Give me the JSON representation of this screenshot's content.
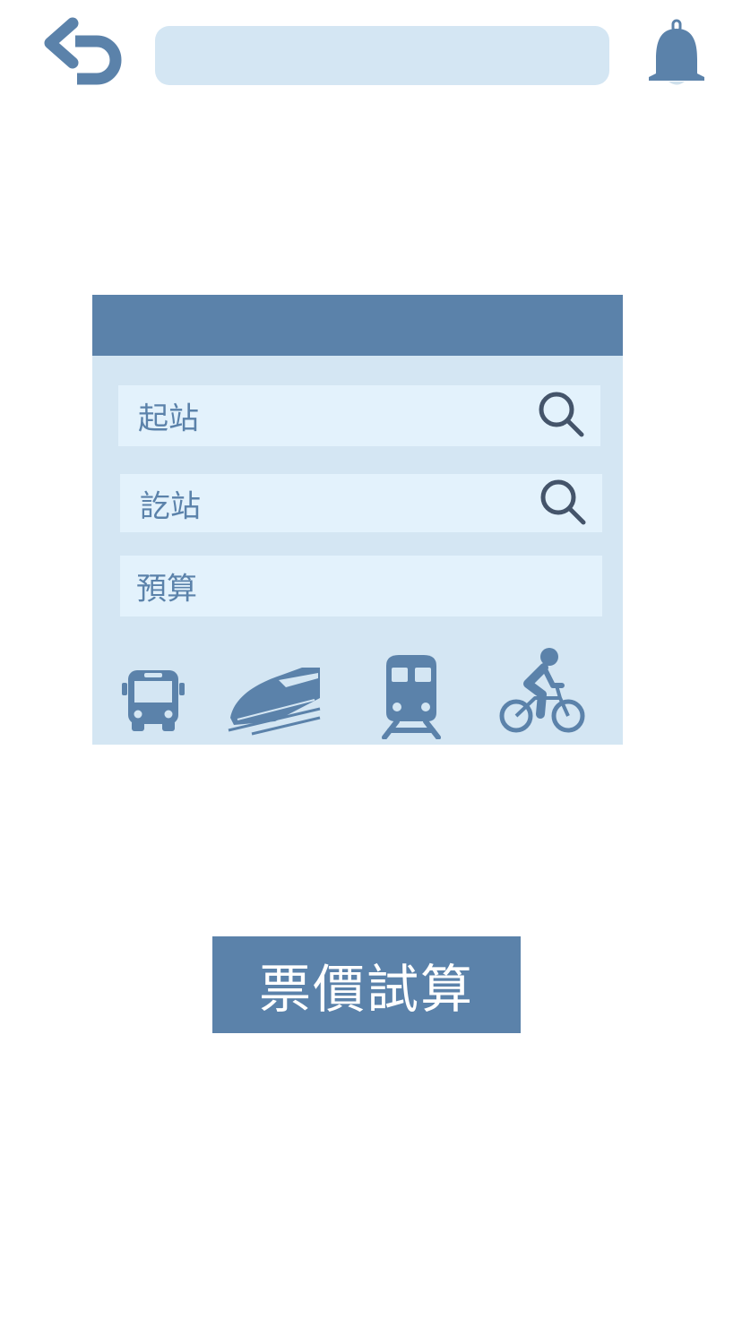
{
  "top_bar": {
    "back_icon": "undo-arrow-icon",
    "search_value": "",
    "bell_icon": "bell-icon"
  },
  "colors": {
    "primary": "#5b82aa",
    "panel_bg": "#d4e6f3",
    "field_bg": "#e3f2fc",
    "search_icon": "#44546a"
  },
  "form": {
    "origin_label": "起站",
    "destination_label": "訖站",
    "budget_label": "預算"
  },
  "transport_modes": [
    "bus-icon",
    "high-speed-rail-icon",
    "train-icon",
    "bicycle-icon"
  ],
  "action": {
    "calculate_label": "票價試算"
  }
}
